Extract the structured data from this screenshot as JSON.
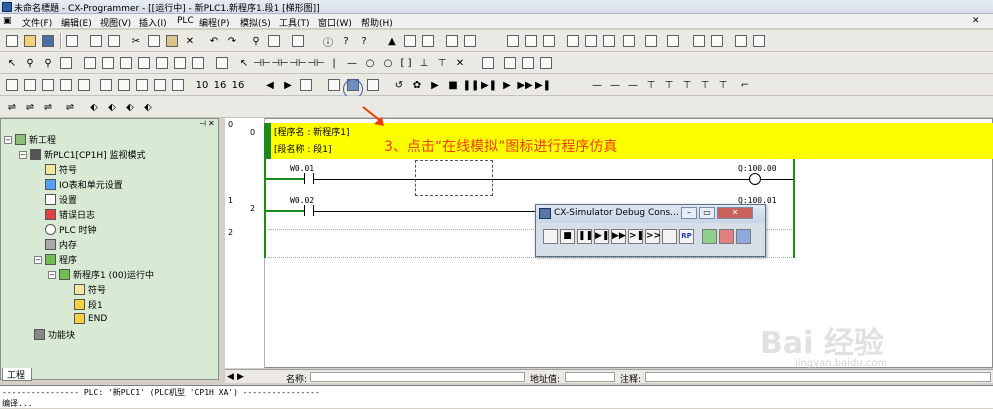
{
  "window": {
    "title": "未命名標題 - CX-Programmer - [[运行中] - 新PLC1.新程序1.段1 [梯形图]]"
  },
  "menu": [
    "文件(F)",
    "编辑(E)",
    "视图(V)",
    "插入(I)",
    "PLC",
    "编程(P)",
    "模拟(S)",
    "工具(T)",
    "窗口(W)",
    "帮助(H)"
  ],
  "tree": {
    "tab": "工程",
    "items": [
      {
        "label": "新工程"
      },
      {
        "label": "新PLC1[CP1H] 监视模式"
      },
      {
        "label": "符号"
      },
      {
        "label": "IO表和单元设置"
      },
      {
        "label": "设置"
      },
      {
        "label": "错误日志"
      },
      {
        "label": "PLC 时钟"
      },
      {
        "label": "内存"
      },
      {
        "label": "程序"
      },
      {
        "label": "新程序1 (00)运行中"
      },
      {
        "label": "符号"
      },
      {
        "label": "段1"
      },
      {
        "label": "END"
      },
      {
        "label": "功能块"
      }
    ]
  },
  "ladder": {
    "header_rung": "0",
    "program_name": "[程序名 : 新程序1]",
    "section_name": "[段名称 : 段1]",
    "annotation": "3、点击“在线模拟”图标进行程序仿真",
    "rung0_index": "0",
    "rung1_index": "1",
    "rung1_step": "2",
    "rung2_index": "2",
    "contact0": "W0.01",
    "coil0": "Q:100.00",
    "contact1": "W0.02",
    "coil1": "Q:100.01"
  },
  "simulator": {
    "title": "CX-Simulator Debug Cons...",
    "buttons": [
      "",
      "■",
      "❚❚",
      "▶❚",
      "▶▶",
      ">❚",
      ">>",
      "",
      "RP",
      "",
      "",
      ""
    ]
  },
  "statusbar": {
    "name_label": "名称:",
    "address_label": "地址值:",
    "comment_label": "注释:"
  },
  "output": {
    "line1": "---------------- PLC: '新PLC1' (PLC机型 'CP1H XA') ----------------",
    "line2": "编译..."
  },
  "watermark": {
    "brand": "Bai 经验",
    "url": "jingyan.baidu.com"
  },
  "colors": {
    "yellow": "#ffff00",
    "rail": "#1e8a1e",
    "annotation": "#f03c00"
  }
}
